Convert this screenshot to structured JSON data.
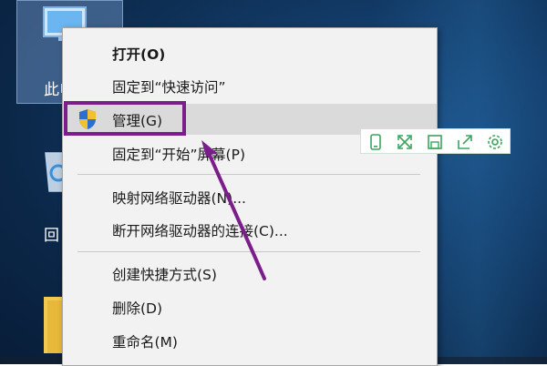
{
  "desktop": {
    "this_pc_label": "此电",
    "recycle_label": "回"
  },
  "context_menu": {
    "items": [
      {
        "label": "打开(O)"
      },
      {
        "label": "固定到“快速访问”"
      },
      {
        "label": "管理(G)"
      },
      {
        "label": "固定到“开始”屏幕(P)"
      },
      {
        "label": "映射网络驱动器(N)..."
      },
      {
        "label": "断开网络驱动器的连接(C)..."
      },
      {
        "label": "创建快捷方式(S)"
      },
      {
        "label": "删除(D)"
      },
      {
        "label": "重命名(M)"
      }
    ]
  },
  "toolbar": {
    "icons": [
      "phone-icon",
      "expand-icon",
      "save-icon",
      "share-icon",
      "settings-icon"
    ],
    "color": "#3aa55d"
  },
  "colors": {
    "highlight_box": "#7b1e8c",
    "arrow": "#7b1e8c",
    "menu_bg": "#f2f2f2",
    "menu_hover": "#dadada"
  }
}
